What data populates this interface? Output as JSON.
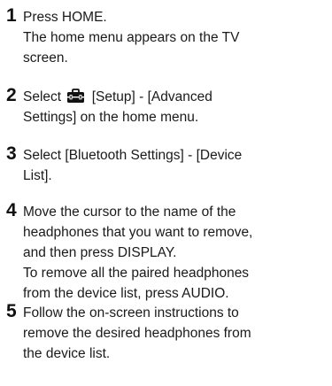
{
  "steps": [
    {
      "number": "1",
      "lines": [
        "Press HOME.",
        "The home menu appears on the TV",
        "screen."
      ]
    },
    {
      "number": "2",
      "lines_prefix": "Select",
      "lines_after_icon": "[Setup] - [Advanced",
      "lines": [
        "Settings] on the home menu."
      ],
      "icon": "toolbox-icon"
    },
    {
      "number": "3",
      "lines": [
        "Select [Bluetooth Settings] - [Device",
        "List]."
      ]
    },
    {
      "number": "4",
      "lines": [
        "Move the cursor to the name of the",
        "headphones that you want to remove,",
        "and then press DISPLAY.",
        "To remove all the paired headphones",
        "from the device list, press AUDIO."
      ]
    },
    {
      "number": "5",
      "lines": [
        "Follow the on-screen instructions to",
        "remove the desired headphones from",
        "the device list."
      ]
    }
  ]
}
